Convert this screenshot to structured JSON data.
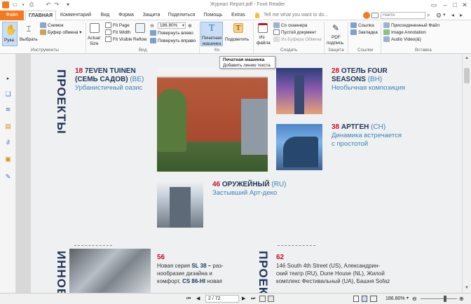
{
  "window": {
    "title": "Журнал Report.pdf - Foxit Reader"
  },
  "tabs": [
    "Файл",
    "ГЛАВНАЯ",
    "Комментарий",
    "Вид",
    "Форма",
    "Защита",
    "Поделиться",
    "Помощь",
    "Extras"
  ],
  "tell_me": "Tell me what you want to do...",
  "find": {
    "placeholder": "Найти"
  },
  "ribbon": {
    "hand": "Рука",
    "select": "Выбрать",
    "snapshot": "Снимок",
    "clipboard": "Буфер обмена",
    "actual_size_1": "Actual",
    "actual_size_2": "Size",
    "fit_page": "Fit Page",
    "fit_width": "Fit Width",
    "fit_visible": "Fit Visible",
    "reflow": "Reflow",
    "zoom": "186.80%",
    "rotate_left": "Повернуть влево",
    "rotate_right": "Повернуть вправо",
    "typewriter_1": "Печатная",
    "typewriter_2": "машинка",
    "highlight": "Подсветить",
    "from_file_1": "Из",
    "from_file_2": "файла",
    "from_scanner": "Со сканнера",
    "blank_doc": "Пустой документ",
    "from_clipboard": "Из Буфера Обмена",
    "pdf_sign_1": "PDF",
    "pdf_sign_2": "подпись",
    "link": "Ссылка",
    "bookmark": "Закладка",
    "file_attachment": "Присоединенный Файл",
    "image_annotation": "Image Annotation",
    "audio_video": "Audio  Video(&)",
    "groups": {
      "tools": "Инструменты",
      "view": "Вид",
      "comment": "Ко",
      "create": "Создать",
      "protect": "Защита",
      "links": "Ссылки",
      "insert": "Вставка"
    }
  },
  "tooltip": {
    "title": "Печатная машинка",
    "desc": "Добавить линию текста"
  },
  "document": {
    "section_projects": "ПРОЕКТЫ",
    "section_innov": "ИННОВ",
    "section_proj2": "ПРОЕК",
    "item18": {
      "num": "18",
      "title1": "7EVEN TUINEN",
      "title2": "(СЕМЬ САДОВ)",
      "suffix": "(BE)",
      "sub": "Урбанистичный оазис"
    },
    "item28": {
      "num": "28",
      "title1": "ОТЕЛЬ FOUR",
      "title2": "SEASONS",
      "suffix": "(BH)",
      "sub": "Необычная композиция"
    },
    "item38": {
      "num": "38",
      "title": "АРТГЕН",
      "suffix": "(CH)",
      "sub1": "Динамика встречается",
      "sub2": "с простотой"
    },
    "item46": {
      "num": "46",
      "title": "ОРУЖЕЙНЫЙ",
      "suffix": "(RU)",
      "sub": "Застывший Арт-деко"
    },
    "item56": {
      "num": "56",
      "line1a": "Новая серия ",
      "line1b": "SL 38 –",
      "line1c": " раз-",
      "line2": "нообразие дизайна и",
      "line3a": "комфорт, ",
      "line3b": "CS 86-HI",
      "line3c": " новая"
    },
    "item62": {
      "num": "62",
      "line1": "146 South 4th Street (US), Александрин-",
      "line2": "ский театр (RU), Dune House (NL), Жилой",
      "line3": "комплекс Фестивальный (UA), Башня Sofaz"
    }
  },
  "status": {
    "page": "2 / 72",
    "zoom": "186.80%"
  }
}
